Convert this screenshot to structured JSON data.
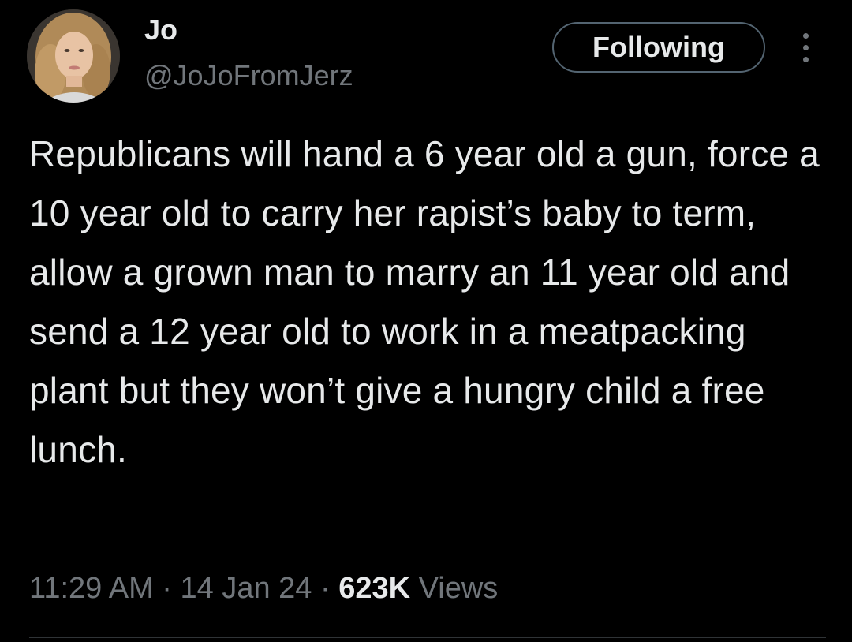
{
  "author": {
    "display_name": "Jo",
    "handle": "@JoJoFromJerz",
    "avatar": "profile-photo"
  },
  "follow_button": {
    "label": "Following"
  },
  "more_button": {
    "icon": "more-vertical-icon"
  },
  "tweet": {
    "text": "Republicans will hand a 6 year old a gun, force a 10 year old to carry her rapist’s baby to term, allow a grown man to marry an 11 year old and send a 12 year old to work in a meatpacking plant but they won’t give a hungry child a free lunch.",
    "time": "11:29 AM",
    "sep1": " · ",
    "date": "14 Jan 24",
    "sep2": " · ",
    "views_count": "623K",
    "views_label": " Views"
  },
  "colors": {
    "background": "#000000",
    "primary_text": "#e7e9ea",
    "secondary_text": "#71767b",
    "button_border": "#536471"
  }
}
